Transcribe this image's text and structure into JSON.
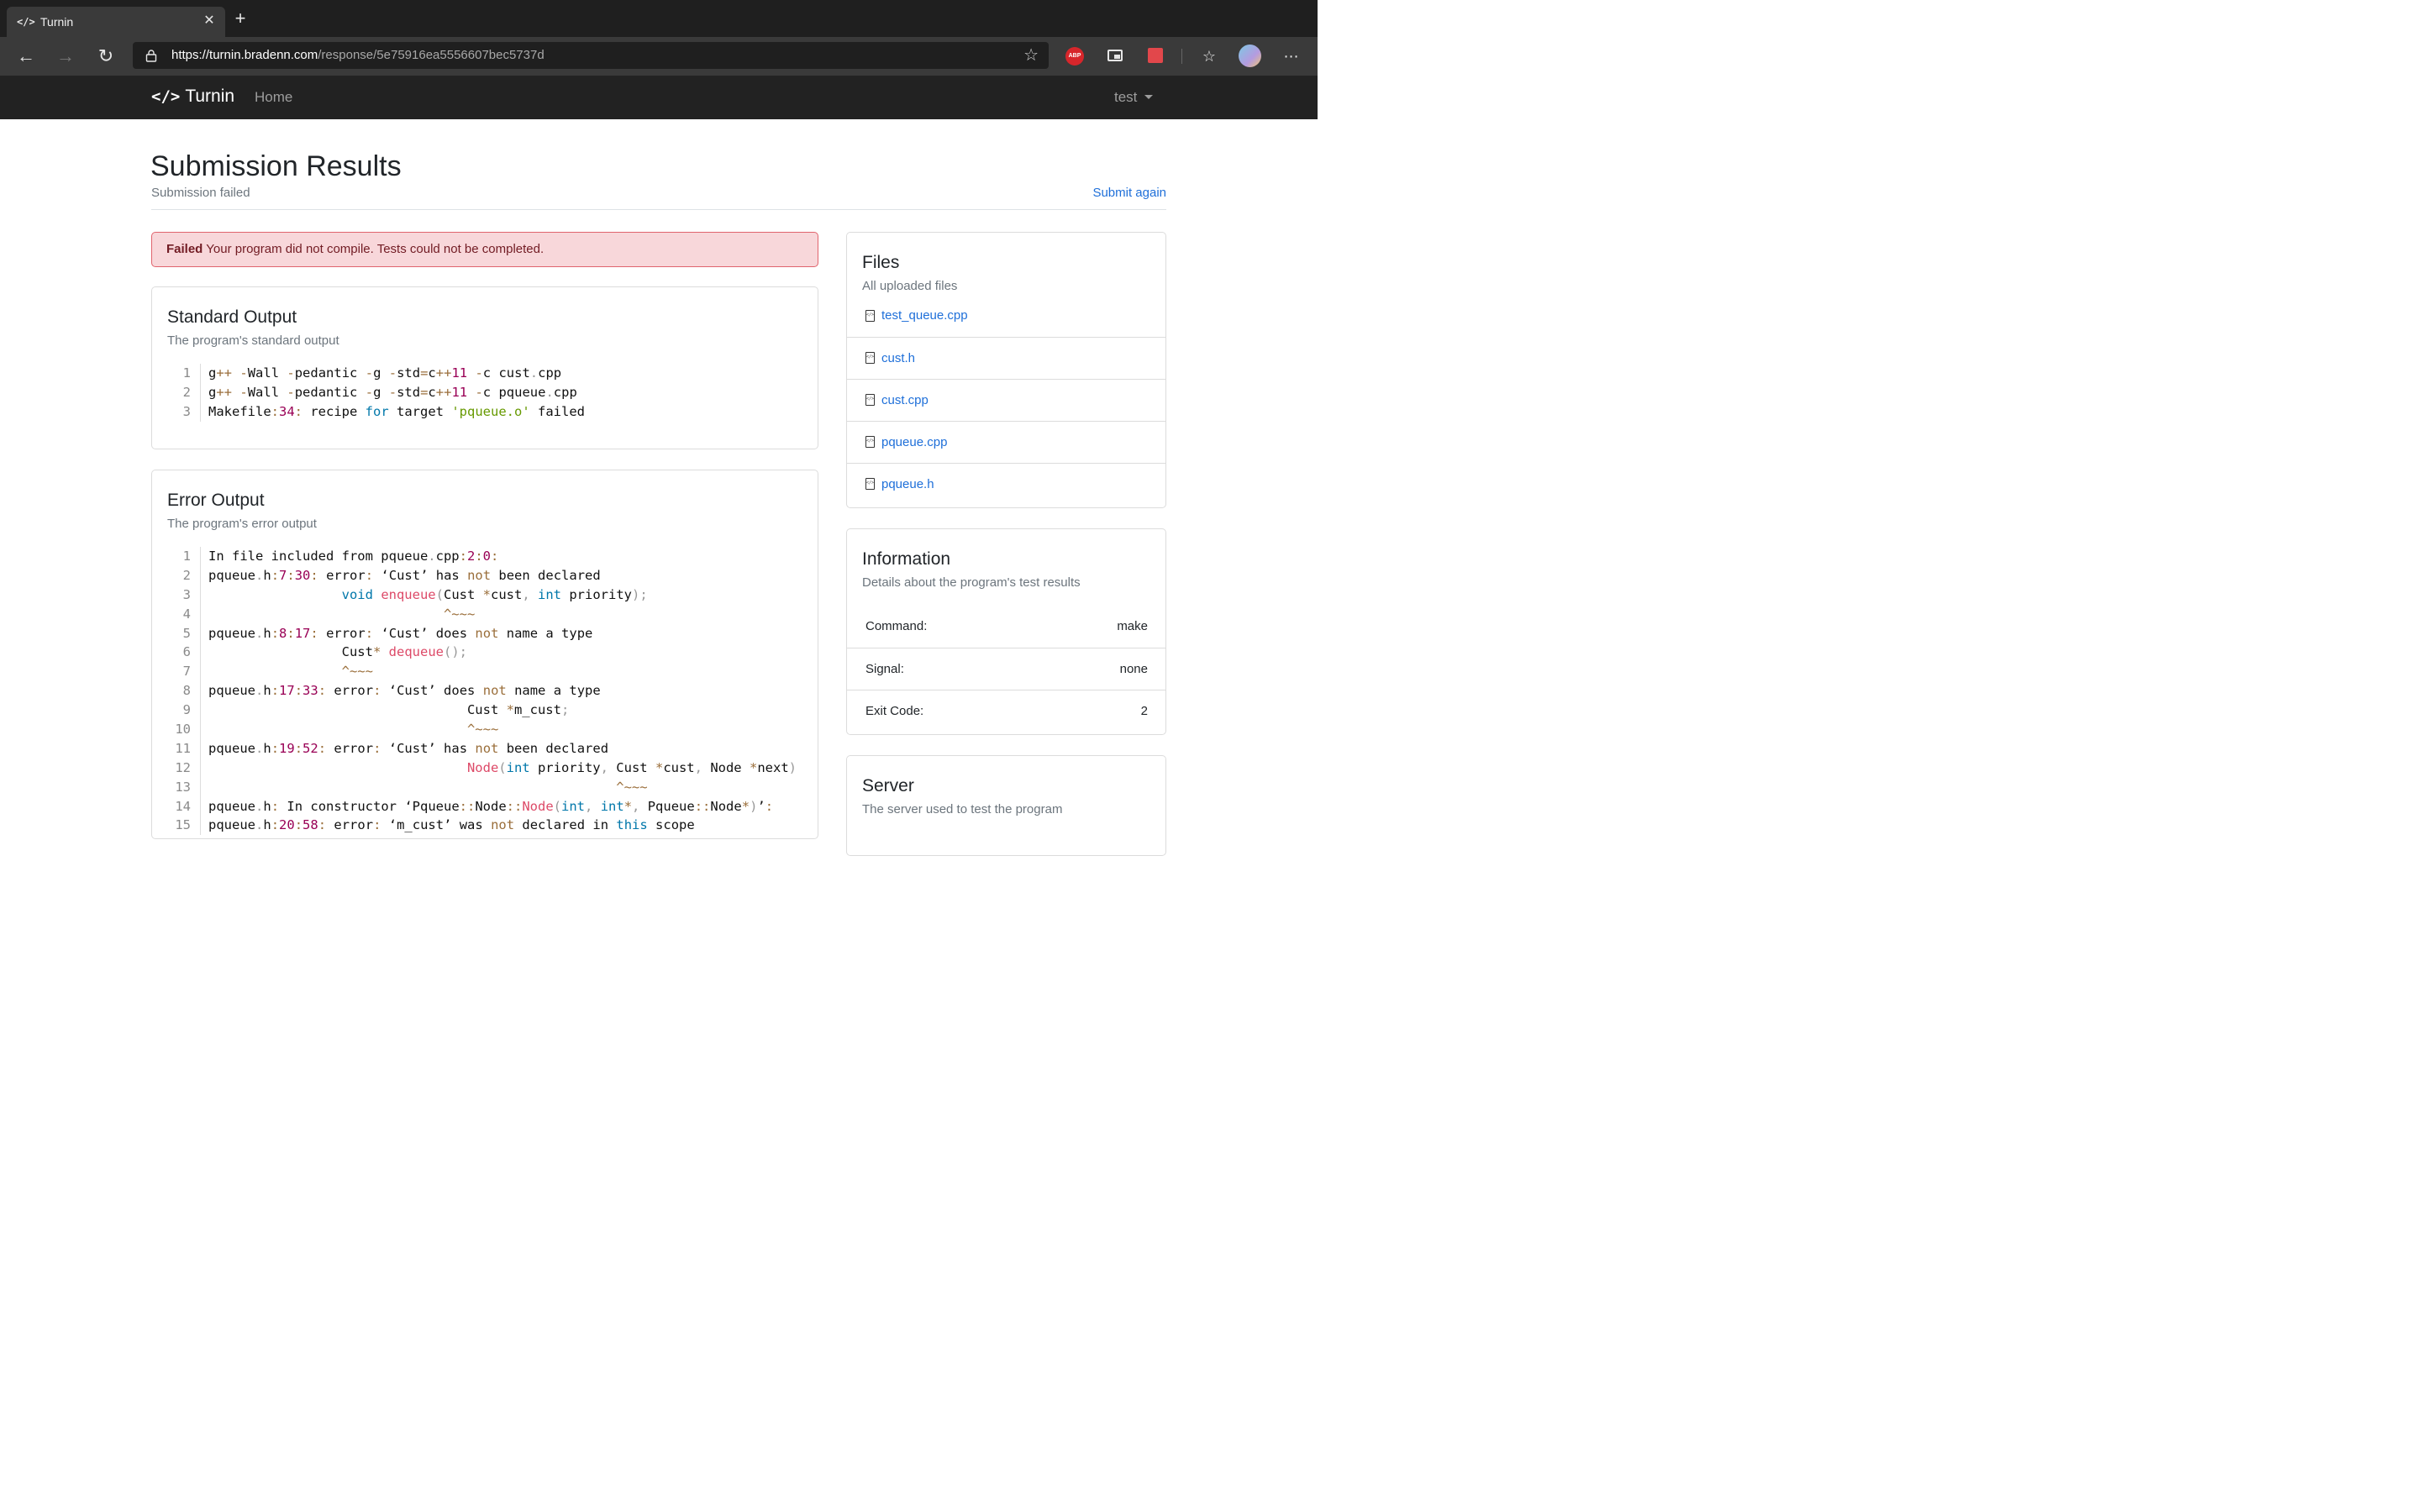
{
  "browser": {
    "tab_title": "Turnin",
    "url_host": "https://turnin.bradenn.com",
    "url_path": "/response/5e75916ea5556607bec5737d",
    "abp_label": "ABP"
  },
  "navbar": {
    "brand": "Turnin",
    "home": "Home",
    "user": "test"
  },
  "page": {
    "title": "Submission Results",
    "subtitle": "Submission failed",
    "submit_again": "Submit again"
  },
  "alert": {
    "strong": "Failed",
    "message": " Your program did not compile. Tests could not be completed."
  },
  "stdout": {
    "title": "Standard Output",
    "subtitle": "The program's standard output",
    "line_numbers": [
      "1",
      "2",
      "3"
    ]
  },
  "stderr": {
    "title": "Error Output",
    "subtitle": "The program's error output",
    "line_numbers": [
      "1",
      "2",
      "3",
      "4",
      "5",
      "6",
      "7",
      "8",
      "9",
      "10",
      "11",
      "12",
      "13",
      "14",
      "15"
    ]
  },
  "files": {
    "title": "Files",
    "subtitle": "All uploaded files",
    "items": [
      "test_queue.cpp",
      "cust.h",
      "cust.cpp",
      "pqueue.cpp",
      "pqueue.h"
    ]
  },
  "information": {
    "title": "Information",
    "subtitle": "Details about the program's test results",
    "rows": [
      {
        "key": "Command:",
        "value": "make"
      },
      {
        "key": "Signal:",
        "value": "none"
      },
      {
        "key": "Exit Code:",
        "value": "2"
      }
    ]
  },
  "server": {
    "title": "Server",
    "subtitle": "The server used to test the program"
  },
  "colors": {
    "link": "#1e6fd9",
    "alert_bg": "#f8d7da",
    "alert_border": "#e0646d",
    "navbar_bg": "#222222"
  }
}
